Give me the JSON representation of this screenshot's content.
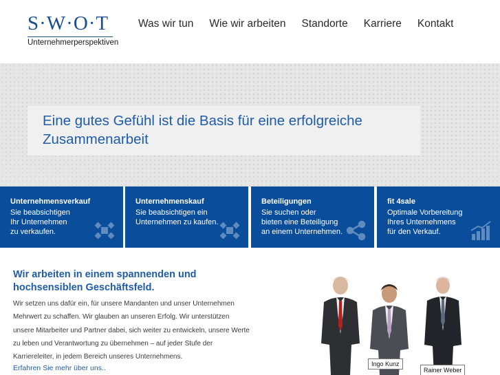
{
  "logo": {
    "wordmark": "S·W·O·T",
    "tagline": "Unternehmerperspektiven"
  },
  "nav": [
    {
      "label": "Was wir tun"
    },
    {
      "label": "Wie wir arbeiten"
    },
    {
      "label": "Standorte"
    },
    {
      "label": "Karriere"
    },
    {
      "label": "Kontakt"
    }
  ],
  "hero": {
    "headline": "Eine gutes Gefühl ist die Basis für eine erfolgreiche Zusammenarbeit"
  },
  "tiles": [
    {
      "title": "Unternehmensverkauf",
      "text": "Sie beabsichtigen\nIhr Unternehmen\nzu verkaufen.",
      "icon": "network-icon"
    },
    {
      "title": "Unternehmenskauf",
      "text": "Sie beabsichtigen ein\nUnternehmen zu kaufen.",
      "icon": "network-icon"
    },
    {
      "title": "Beteiligungen",
      "text": "Sie suchen oder\nbieten eine Beteiligung\nan einem Unternehmen.",
      "icon": "share-icon"
    },
    {
      "title": "fit 4sale",
      "text": "Optimale Vorbereitung\nIhres Unternehmens\nfür den Verkauf.",
      "icon": "bar-chart-icon"
    }
  ],
  "content": {
    "heading": "Wir arbeiten in einem spannenden und hochsensiblen Geschäftsfeld.",
    "body": "Wir setzen uns dafür ein, für unsere Mandanten und unser Unternehmen\nMehrwert zu schaffen. Wir glauben an unseren Erfolg. Wir unterstützen\nunsere Mitarbeiter und Partner dabei, sich weiter zu entwickeln, unsere Werte\nzu leben und Verantwortung zu übernehmen – auf jeder Stufe der\nKarriereleiter, in jedem Bereich unseres Unternehmens.",
    "link": "Erfahren Sie mehr über uns.."
  },
  "people": [
    {
      "name": "Ingo Kunz"
    },
    {
      "name": "Rainer Weber"
    }
  ],
  "colors": {
    "brand_blue": "#0a4d9b",
    "text_blue": "#1f5ca8"
  }
}
